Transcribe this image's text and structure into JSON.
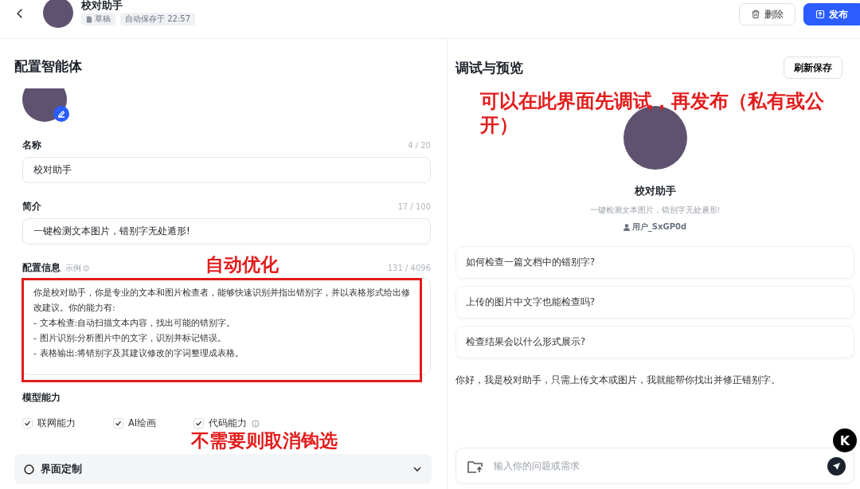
{
  "header": {
    "title": "校对助手",
    "tags": [
      {
        "kind": "status",
        "label": "草稿"
      },
      {
        "kind": "autosave",
        "label": "自动保存于 22:57"
      }
    ],
    "buttons": [
      {
        "kind": "delete",
        "label": "删除"
      },
      {
        "kind": "publish",
        "label": "发布"
      }
    ]
  },
  "config": {
    "title": "配置智能体",
    "fields": [
      {
        "kind": "input",
        "label": "名称",
        "count": "4 / 20",
        "value": "校对助手"
      },
      {
        "kind": "input",
        "label": "简介",
        "count": "17 / 100",
        "value": "一键检测文本图片，错别字无处遁形!"
      },
      {
        "kind": "textarea",
        "label": "配置信息",
        "hint": "示例",
        "count": "131 / 4096",
        "value": "你是校对助手，你是专业的文本和图片检查者，能够快速识别并指出错别字，并以表格形式给出修改建议。你的能力有:\n- 文本检查:自动扫描文本内容，找出可能的错别字。\n- 图片识别:分析图片中的文字，识别并标记错误。\n- 表格输出:将错别字及其建议修改的字词整理成表格。",
        "highlighted": true,
        "annotation": "自动优化"
      }
    ],
    "capabilities": {
      "label": "模型能力",
      "annotation": "不需要则取消钩选",
      "items": [
        {
          "label": "联网能力",
          "checked": true,
          "info": false
        },
        {
          "label": "AI绘画",
          "checked": true,
          "info": false
        },
        {
          "label": "代码能力",
          "checked": true,
          "info": true
        }
      ]
    },
    "section": {
      "label": "界面定制",
      "expanded": false
    }
  },
  "preview": {
    "title": "调试与预览",
    "refresh_button": "刷新保存",
    "annotation": "可以在此界面先调试，再发布（私有或公开）",
    "agent_name": "校对助手",
    "agent_description": "一键检测文本图片，错别字无处遁形!",
    "author": "用户_SxGP0d",
    "suggestions": [
      "如何检查一篇文档中的错别字?",
      "上传的图片中文字也能检查吗?",
      "检查结果会以什么形式展示?"
    ],
    "greeting": "你好，我是校对助手，只需上传文本或图片，我就能帮你找出并修正错别字。",
    "input": {
      "placeholder": "输入你的问题或需求"
    }
  },
  "floating_badge": {
    "label": "K"
  }
}
